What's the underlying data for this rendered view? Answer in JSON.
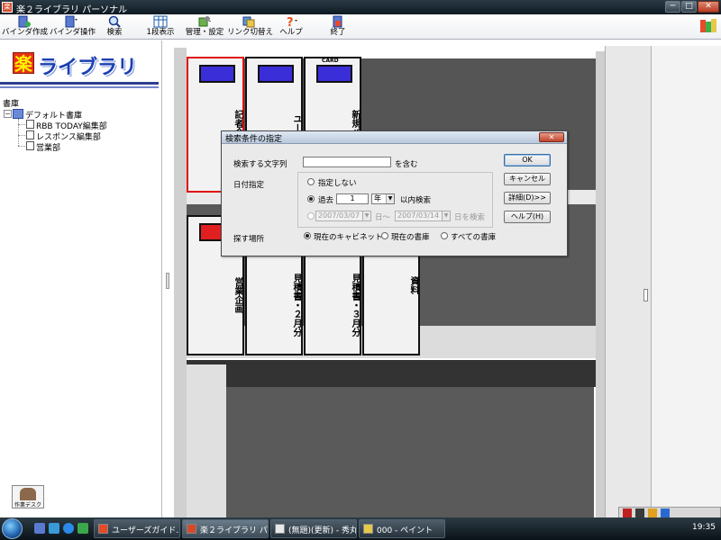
{
  "window": {
    "title": "楽２ライブラリ パーソナル",
    "min": "─",
    "max": "□",
    "close": "✕"
  },
  "toolbar": {
    "binder_create": "バインダ作成",
    "binder_ops": "バインダ操作",
    "search": "検索",
    "one_row": "1段表示",
    "admin": "管理・設定",
    "link_switch": "リンク切替え",
    "help": "ヘルプ",
    "exit": "終了"
  },
  "logo": {
    "kanji": "楽",
    "text": "ライブラリ"
  },
  "tree": {
    "root": "書庫",
    "expand": "−",
    "library": "デフォルト書庫",
    "items": [
      "RBB TODAY編集部",
      "レスポンス編集部",
      "営業部"
    ]
  },
  "desk_button": "作業デスク",
  "binders": [
    {
      "title": "記者会見案内",
      "cap_color": "#3a2ed8",
      "selected": true
    },
    {
      "title": "ユーザーズ",
      "cap_color": "#3a2ed8",
      "selected": false
    },
    {
      "title": "新規バインダ",
      "cap_color": "#3a2ed8",
      "label": "CARD",
      "selected": false
    },
    {
      "title": "営業企画",
      "cap_color": "#e02020",
      "selected": false
    },
    {
      "title": "見積書・２月分",
      "selected": false
    },
    {
      "title": "見積書・３月分",
      "selected": false
    },
    {
      "title": "資料",
      "selected": false
    }
  ],
  "dialog": {
    "title": "検索条件の指定",
    "close": "✕",
    "search_label": "検索する文字列",
    "search_value": "",
    "contains": "を含む",
    "date_label": "日付指定",
    "opt_none": "指定しない",
    "opt_past": "過去",
    "past_value": "1",
    "past_unit": "年",
    "within": "以内検索",
    "date_from": "2007/03/07",
    "day_sep": "日〜",
    "date_to": "2007/03/14",
    "day_search": "日を検索",
    "location_label": "探す場所",
    "loc_cabinet": "現在のキャビネット",
    "loc_library": "現在の書庫",
    "loc_all": "すべての書庫",
    "ok": "OK",
    "cancel": "キャンセル",
    "details": "詳細(D)>>",
    "help": "ヘルプ(H)"
  },
  "taskbar": {
    "tasks": [
      {
        "label": "ユーザーズガイド..."
      },
      {
        "label": "楽２ライブラリ パ..."
      },
      {
        "label": "(無題)(更新) - 秀丸"
      },
      {
        "label": "000 - ペイント"
      }
    ],
    "clock": "19:35"
  },
  "colors": {
    "accent": "#1a3fb4",
    "binder_blue": "#3a2ed8",
    "binder_red": "#e02020",
    "selected_border": "#e01010"
  }
}
